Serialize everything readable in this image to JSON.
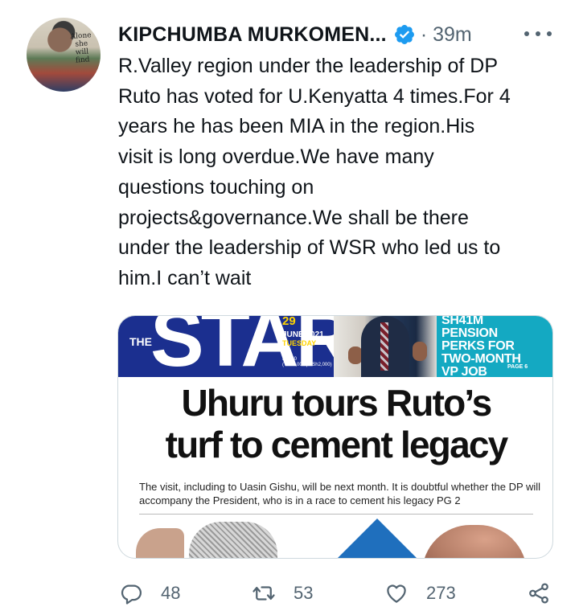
{
  "tweet": {
    "author_name": "KIPCHUMBA MURKOMEN...",
    "time": "39m",
    "text": "R.Valley region under the leadership of DP\nRuto has voted for U.Kenyatta 4 times.For 4\nyears he has been MIA in the region.His\nvisit is long overdue.We have many\nquestions touching on\nprojects&governance.We shall be there\nunder the leadership of WSR who led us to\nhim.I can’t wait"
  },
  "avatar": {
    "scrawl": "Alone\nshe\nwill\nfind"
  },
  "newspaper": {
    "the_label": "THE",
    "masthead": "STAR",
    "day": "29",
    "date": "JUNE 2021",
    "weekday": "TUESDAY",
    "price": "KSh60\n(TSh1,000 | USh2,000)",
    "teaser": "SH41M PENSION PERKS FOR TWO-MONTH VP JOB",
    "teaser_page": "PAGE 6",
    "headline": "Uhuru tours Ruto’s\nturf to cement legacy",
    "standfirst": "The visit, including to Uasin Gishu, will be next month. It is doubtful whether the DP will accompany the President, who is in a race to cement his legacy PG 2"
  },
  "actions": {
    "reply_count": "48",
    "retweet_count": "53",
    "like_count": "273"
  },
  "icons": {
    "verified": "verified-badge-icon",
    "more": "more-dots-icon",
    "reply": "reply-icon",
    "retweet": "retweet-icon",
    "like": "heart-icon",
    "share": "share-icon"
  },
  "colors": {
    "verified": "#1d9bf0",
    "secondary_text": "#536471",
    "star_blue": "#1b2f8f",
    "teaser_teal": "#14a9c2"
  }
}
